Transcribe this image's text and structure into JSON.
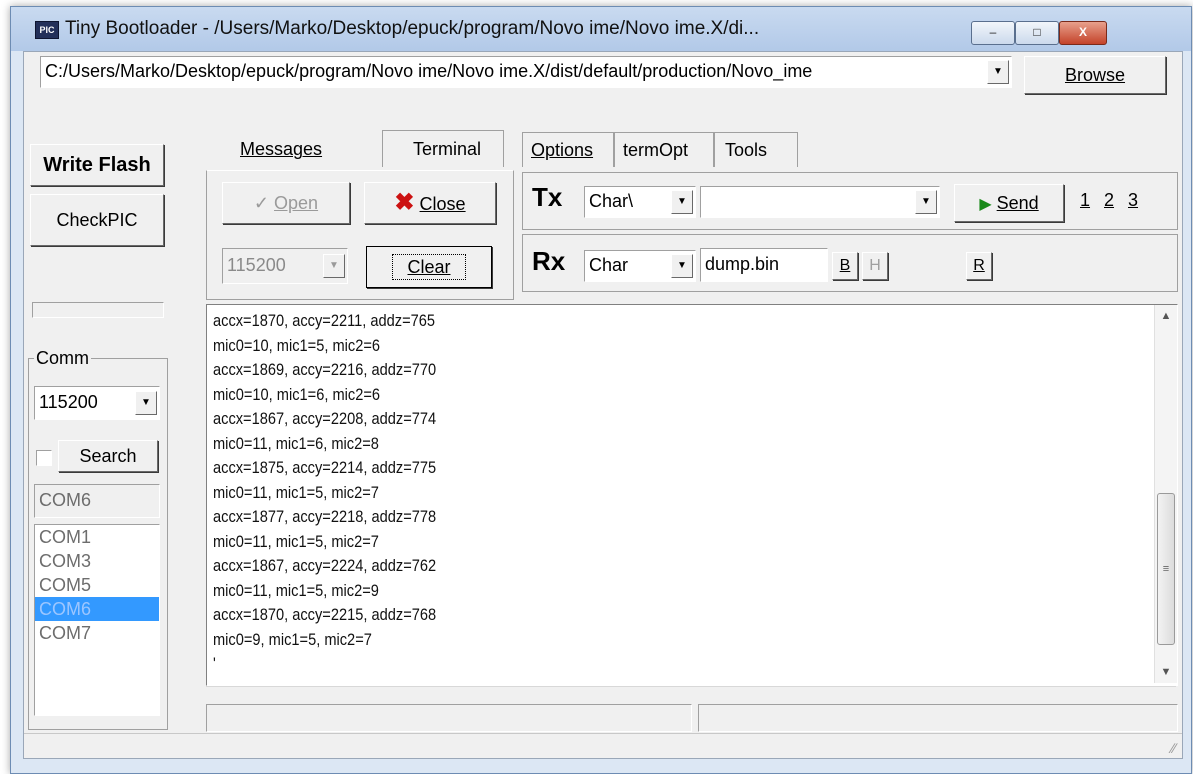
{
  "window": {
    "title": "Tiny Bootloader - /Users/Marko/Desktop/epuck/program/Novo ime/Novo ime.X/di...",
    "icon_text": "PIC",
    "min_label": "–",
    "max_label": "□",
    "close_label": "X"
  },
  "file": {
    "path_value": "C:/Users/Marko/Desktop/epuck/program/Novo ime/Novo ime.X/dist/default/production/Novo_ime",
    "browse_label": "Browse"
  },
  "left_panel": {
    "write_flash_label": "Write Flash",
    "checkpic_label": "CheckPIC",
    "comm_group_label": "Comm",
    "baud_value": "115200",
    "search_label": "Search",
    "search_checked": false,
    "selected_port": "COM6",
    "ports": [
      "COM1",
      "COM3",
      "COM5",
      "COM6",
      "COM7"
    ],
    "highlighted_port_index": 3
  },
  "tabs_left": {
    "messages_label": "Messages",
    "terminal_label": "Terminal",
    "active": "Terminal"
  },
  "tabs_right": {
    "options_label": "Options",
    "termopt_label": "termOpt",
    "tools_label": "Tools"
  },
  "terminal_controls": {
    "open_label": "Open",
    "close_label": "Close",
    "baud_value": "115200",
    "clear_label": "Clear"
  },
  "tx": {
    "label": "Tx",
    "mode_value": "Char\\",
    "input_value": "",
    "send_label": "Send",
    "macro_buttons": [
      "1",
      "2",
      "3"
    ]
  },
  "rx": {
    "label": "Rx",
    "mode_value": "Char",
    "file_value": "dump.bin",
    "b_label": "B",
    "h_label": "H",
    "r_label": "R"
  },
  "terminal_output": [
    "accx=1870, accy=2211, addz=765",
    "mic0=10, mic1=5, mic2=6",
    "accx=1869, accy=2216, addz=770",
    "mic0=10, mic1=6, mic2=6",
    "accx=1867, accy=2208, addz=774",
    "mic0=11, mic1=6, mic2=8",
    "accx=1875, accy=2214, addz=775",
    "mic0=11, mic1=5, mic2=7",
    "accx=1877, accy=2218, addz=778",
    "mic0=11, mic1=5, mic2=7",
    "accx=1867, accy=2224, addz=762",
    "mic0=11, mic1=5, mic2=9",
    "accx=1870, accy=2215, addz=768",
    "mic0=9, mic1=5, mic2=7",
    "'"
  ],
  "colors": {
    "selection": "#3399ff",
    "close_icon": "#cc1111",
    "send_icon": "#1a8a1a",
    "title_bg": "#c9daf0"
  }
}
